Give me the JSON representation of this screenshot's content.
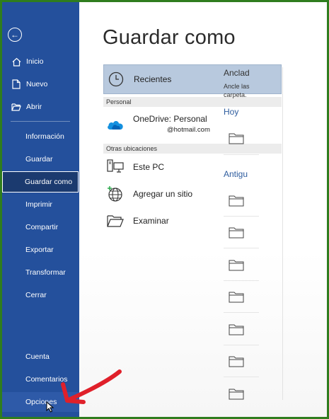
{
  "sidebar": {
    "items": [
      {
        "label": "Inicio",
        "icon": "home-icon"
      },
      {
        "label": "Nuevo",
        "icon": "new-document-icon"
      },
      {
        "label": "Abrir",
        "icon": "open-folder-icon"
      },
      {
        "label": "Información"
      },
      {
        "label": "Guardar"
      },
      {
        "label": "Guardar como"
      },
      {
        "label": "Imprimir"
      },
      {
        "label": "Compartir"
      },
      {
        "label": "Exportar"
      },
      {
        "label": "Transformar"
      },
      {
        "label": "Cerrar"
      },
      {
        "label": "Cuenta"
      },
      {
        "label": "Comentarios"
      },
      {
        "label": "Opciones"
      }
    ],
    "active": "Guardar como"
  },
  "main": {
    "title": "Guardar como",
    "recent_label": "Recientes",
    "personal_header": "Personal",
    "onedrive_name": "OneDrive: Personal",
    "onedrive_email": "@hotmail.com",
    "other_header": "Otras ubicaciones",
    "this_pc": "Este PC",
    "add_site": "Agregar un sitio",
    "browse": "Examinar"
  },
  "right": {
    "pinned_title": "Anclad",
    "pinned_desc_1": "Ancle las",
    "pinned_desc_2": "carpeta.",
    "today": "Hoy",
    "older": "Antigu"
  },
  "colors": {
    "sidebar": "#24509c",
    "active_item": "#1b3a6f",
    "selected_location": "#b8c9de",
    "annotation_arrow": "#e0202a",
    "frame_border": "#2f7d1e"
  }
}
